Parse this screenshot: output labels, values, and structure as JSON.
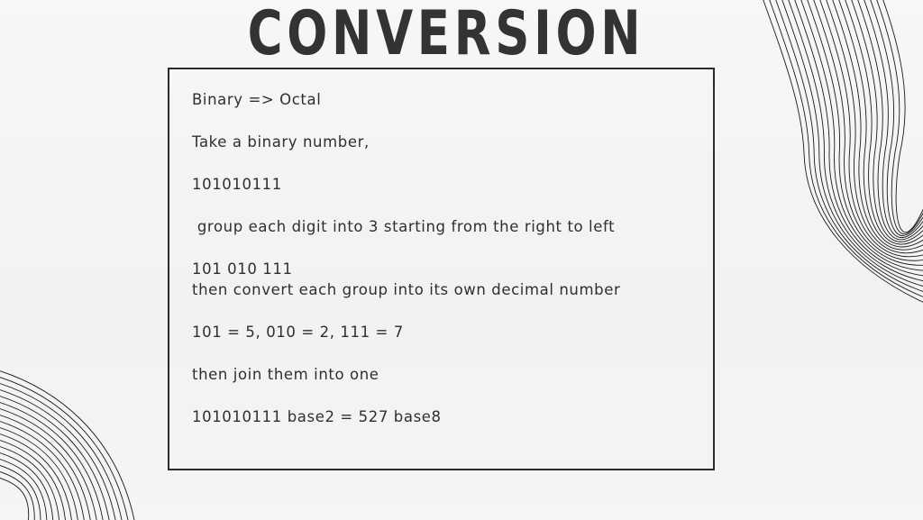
{
  "slide": {
    "title": "CONVERSION",
    "lines": [
      "Binary => Octal",
      "Take a binary number,",
      "101010111",
      " group each digit into 3 starting from the right to left",
      "101 010 111",
      "then convert each group into its own decimal number",
      "101 = 5, 010 = 2, 111 = 7",
      "then join them into one",
      "101010111 base2 = 527 base8"
    ]
  },
  "colors": {
    "background": "#f4f5f5",
    "text": "#2f2f2f",
    "title": "#333333",
    "border": "#2b2b2b",
    "decoration_lines": "#1a1a1a"
  }
}
